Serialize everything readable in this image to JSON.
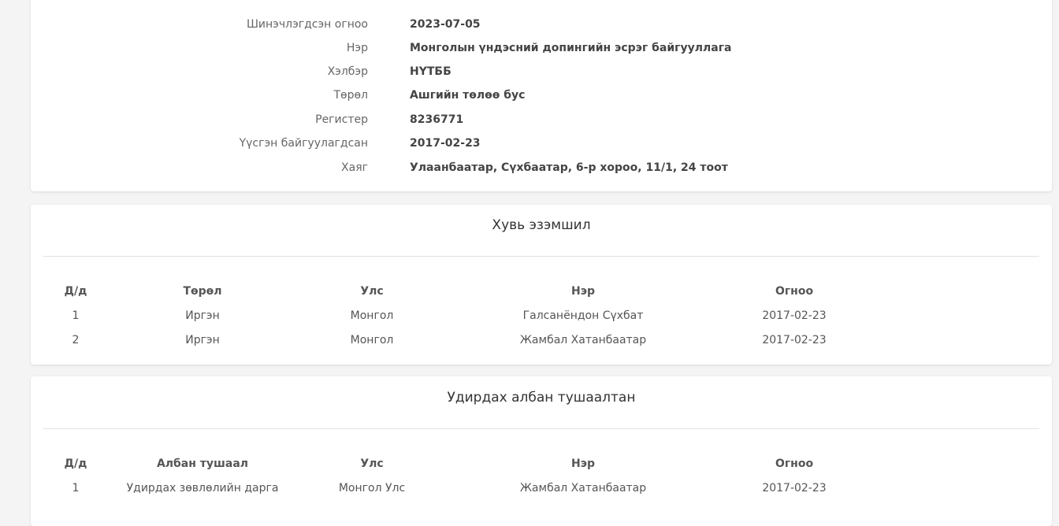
{
  "info": {
    "rows": [
      {
        "label": "Шинэчлэгдсэн огноо",
        "value": "2023-07-05"
      },
      {
        "label": "Нэр",
        "value": "Монголын үндэсний допингийн эсрэг байгууллага"
      },
      {
        "label": "Хэлбэр",
        "value": "НҮТББ"
      },
      {
        "label": "Төрөл",
        "value": "Ашгийн төлөө бус"
      },
      {
        "label": "Регистер",
        "value": "8236771"
      },
      {
        "label": "Үүсгэн байгуулагдсан",
        "value": "2017-02-23"
      },
      {
        "label": "Хаяг",
        "value": "Улаанбаатар, Сүхбаатар, 6-р хороо, 11/1, 24 тоот"
      }
    ]
  },
  "ownership": {
    "title": "Хувь эзэмшил",
    "headers": [
      "Д/д",
      "Төрөл",
      "Улс",
      "Нэр",
      "Огноо"
    ],
    "rows": [
      [
        "1",
        "Иргэн",
        "Монгол",
        "Галсанёндон Сүхбат",
        "2017-02-23"
      ],
      [
        "2",
        "Иргэн",
        "Монгол",
        "Жамбал Хатанбаатар",
        "2017-02-23"
      ]
    ]
  },
  "officials": {
    "title": "Удирдах албан тушаалтан",
    "headers": [
      "Д/д",
      "Албан тушаал",
      "Улс",
      "Нэр",
      "Огноо"
    ],
    "rows": [
      [
        "1",
        "Удирдах зөвлөлийн дарга",
        "Монгол Улс",
        "Жамбал Хатанбаатар",
        "2017-02-23"
      ]
    ]
  }
}
